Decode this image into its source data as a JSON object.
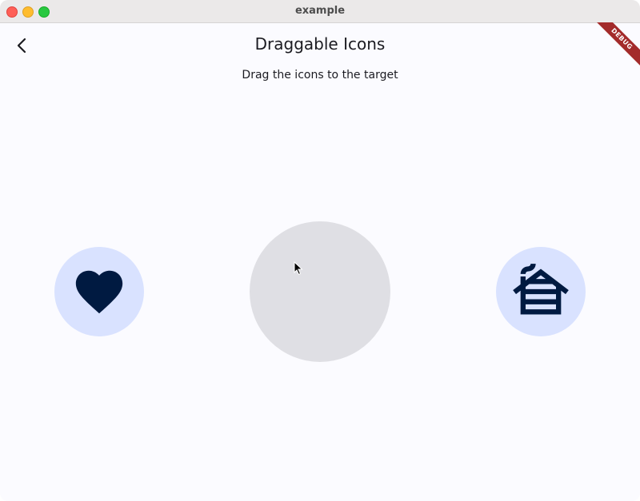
{
  "window": {
    "title": "example"
  },
  "appbar": {
    "back_icon": "chevron-left-icon",
    "title": "Draggable Icons"
  },
  "content": {
    "subtitle": "Drag the icons to the target",
    "left_icon": "heart-icon",
    "right_icon": "cabin-icon"
  },
  "debug_banner": {
    "label": "DEBUG"
  },
  "colors": {
    "icon_bg": "#d9e2ff",
    "icon_fg": "#001a41",
    "target_bg": "#dfdfe4",
    "debug_bg": "#a32b2b"
  }
}
